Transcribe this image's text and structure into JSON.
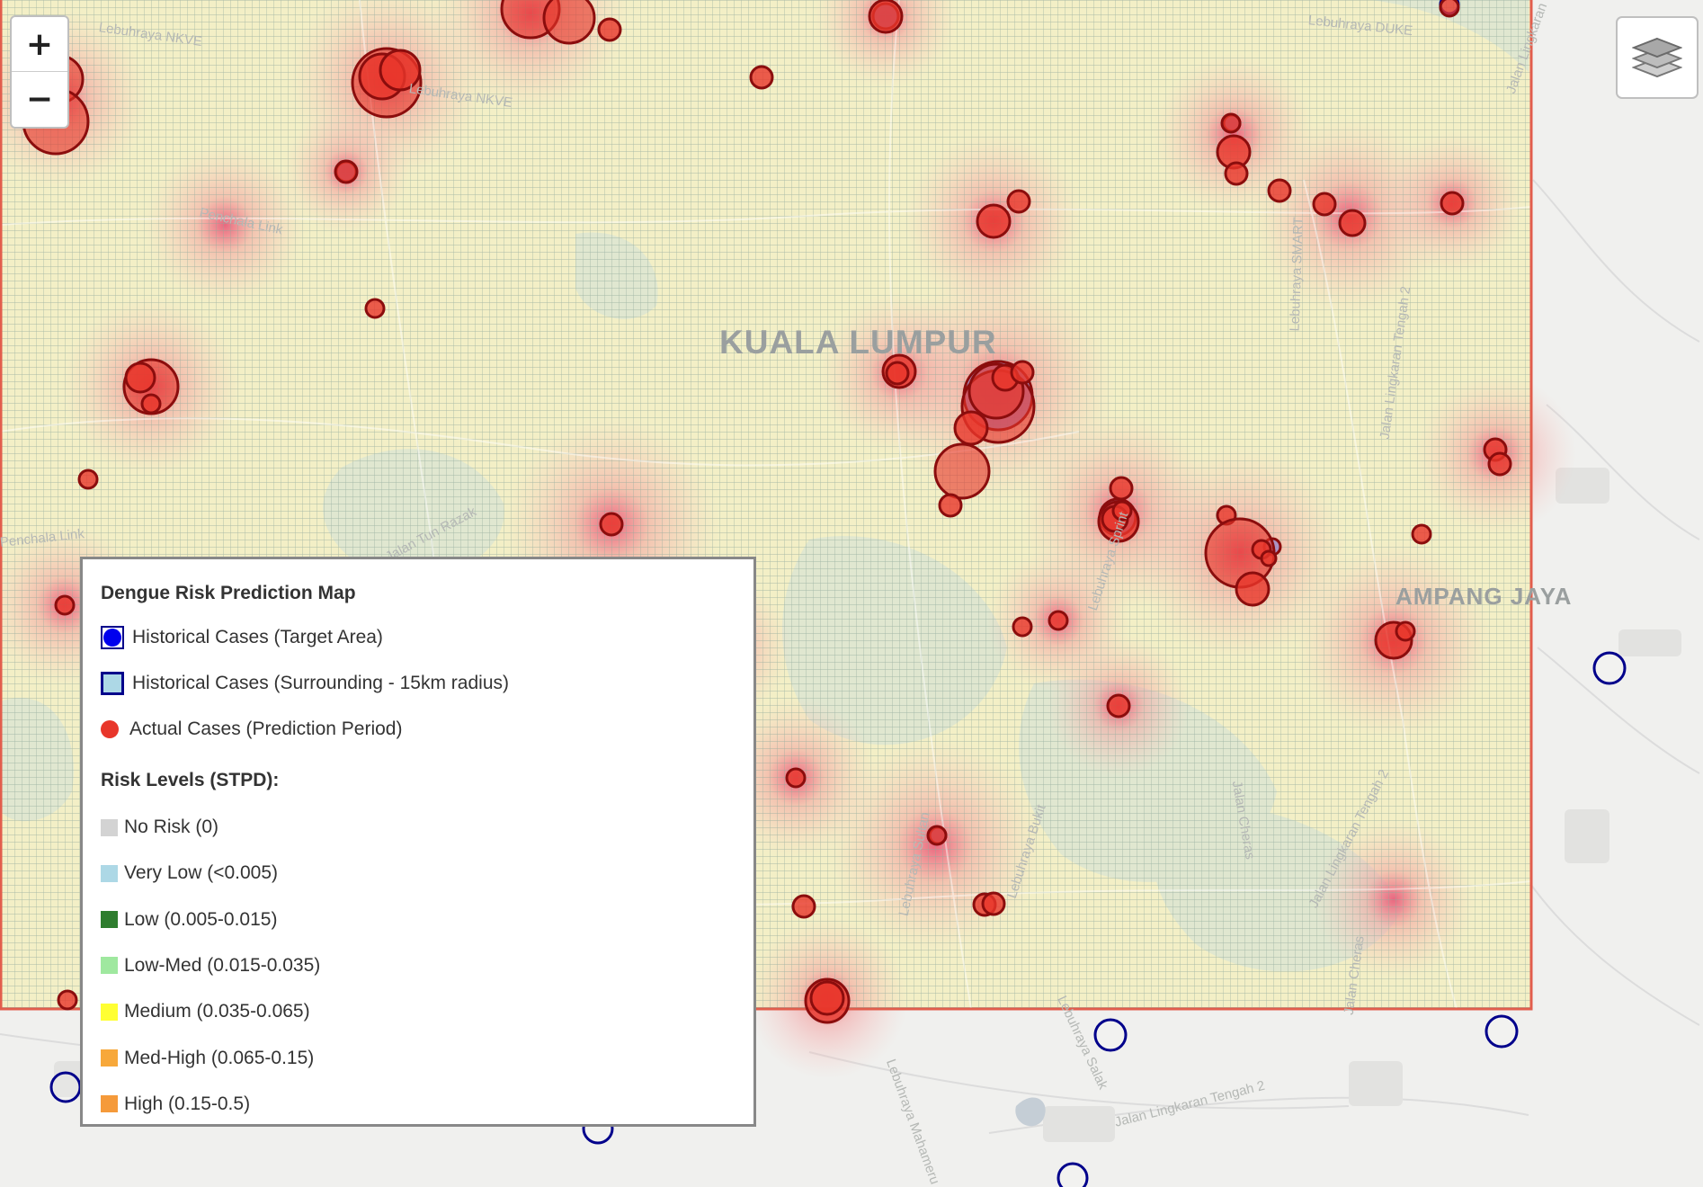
{
  "map": {
    "place_labels": {
      "city": "KUALA LUMPUR",
      "district": "AMPANG JAYA"
    },
    "street_labels": [
      "Lebuhraya NKVE",
      "Lebuhraya NKVE",
      "Penchala Link",
      "Penchala Link",
      "Jalan Tun Razak",
      "Lebuhraya DUKE",
      "Jalan Lingkaran",
      "Lebuhraya SMART",
      "Jalan Lingkaran Tengah 2",
      "Jalan Cheras",
      "Jalan Lingkaran Tengah 2",
      "Lebuhraya Sultan",
      "Lebuhraya Bukit",
      "Lebuhraya Salak",
      "Lebuhraya Mahameru",
      "Lebuhraya Sprint",
      "Jalan Lingkaran Tengah 2",
      "Jalan Cheras"
    ],
    "colors": {
      "actual_case_fill": "#e8362a",
      "actual_case_stroke": "#8b0d0d",
      "historical_target_fill": "#9a86c8",
      "surrounding_stroke": "#00008b",
      "grid_line": "#8fa89a",
      "grid_fill": "#f3efc6",
      "boundary_stroke": "#e25d4c"
    }
  },
  "controls": {
    "zoom_in": "+",
    "zoom_out": "−",
    "layers_icon": "layers-icon"
  },
  "legend": {
    "title": "Dengue Risk Prediction Map",
    "historical_target": {
      "label": "Historical Cases (Target Area)",
      "color": "#0000ee",
      "border": "#00008b"
    },
    "historical_surrounding": {
      "label": "Historical Cases (Surrounding - 15km radius)",
      "color": "#add8e6",
      "border": "#00008b"
    },
    "actual_cases": {
      "label": "Actual Cases (Prediction Period)",
      "color": "#e8362a"
    },
    "risk_heading": "Risk Levels (STPD):",
    "risk_levels": [
      {
        "label": "No Risk (0)",
        "color": "#d3d3d3"
      },
      {
        "label": "Very Low (<0.005)",
        "color": "#add8e6"
      },
      {
        "label": "Low (0.005-0.015)",
        "color": "#2e7d2e"
      },
      {
        "label": "Low-Med (0.015-0.035)",
        "color": "#9fe89f"
      },
      {
        "label": "Medium (0.035-0.065)",
        "color": "#ffff33"
      },
      {
        "label": "Med-High (0.065-0.15)",
        "color": "#f7a83a"
      },
      {
        "label": "High (0.15-0.5)",
        "color": "#f59a3a"
      }
    ]
  }
}
